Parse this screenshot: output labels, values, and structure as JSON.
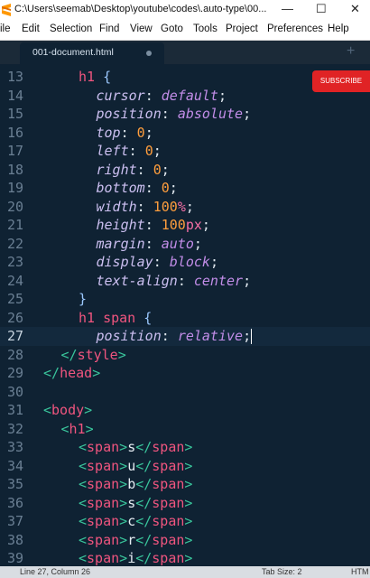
{
  "window": {
    "title": "C:\\Users\\seemab\\Desktop\\youtube\\codes\\.auto-type\\00...",
    "minimize": "—",
    "maximize": "☐",
    "close": "✕"
  },
  "menu": [
    "ile",
    "Edit",
    "Selection",
    "Find",
    "View",
    "Goto",
    "Tools",
    "Project",
    "Preferences",
    "Help"
  ],
  "tab": {
    "label": "001-document.html"
  },
  "overlay": {
    "subscribe_label": "SUBSCRIBE"
  },
  "lines": [
    {
      "n": "13",
      "parts": [
        [
          "sel",
          "h1"
        ],
        [
          "pun",
          " "
        ],
        [
          "br",
          "{"
        ]
      ]
    },
    {
      "n": "14",
      "parts": [
        [
          "prop",
          "cursor"
        ],
        [
          "pun",
          ": "
        ],
        [
          "val",
          "default"
        ],
        [
          "pun",
          ";"
        ]
      ]
    },
    {
      "n": "15",
      "parts": [
        [
          "prop",
          "position"
        ],
        [
          "pun",
          ": "
        ],
        [
          "val",
          "absolute"
        ],
        [
          "pun",
          ";"
        ]
      ]
    },
    {
      "n": "16",
      "parts": [
        [
          "prop",
          "top"
        ],
        [
          "pun",
          ": "
        ],
        [
          "num",
          "0"
        ],
        [
          "pun",
          ";"
        ]
      ]
    },
    {
      "n": "17",
      "parts": [
        [
          "prop",
          "left"
        ],
        [
          "pun",
          ": "
        ],
        [
          "num",
          "0"
        ],
        [
          "pun",
          ";"
        ]
      ]
    },
    {
      "n": "18",
      "parts": [
        [
          "prop",
          "right"
        ],
        [
          "pun",
          ": "
        ],
        [
          "num",
          "0"
        ],
        [
          "pun",
          ";"
        ]
      ]
    },
    {
      "n": "19",
      "parts": [
        [
          "prop",
          "bottom"
        ],
        [
          "pun",
          ": "
        ],
        [
          "num",
          "0"
        ],
        [
          "pun",
          ";"
        ]
      ]
    },
    {
      "n": "20",
      "parts": [
        [
          "prop",
          "width"
        ],
        [
          "pun",
          ": "
        ],
        [
          "num",
          "100"
        ],
        [
          "unit",
          "%"
        ],
        [
          "pun",
          ";"
        ]
      ]
    },
    {
      "n": "21",
      "parts": [
        [
          "prop",
          "height"
        ],
        [
          "pun",
          ": "
        ],
        [
          "num",
          "100"
        ],
        [
          "unit",
          "px"
        ],
        [
          "pun",
          ";"
        ]
      ]
    },
    {
      "n": "22",
      "parts": [
        [
          "prop",
          "margin"
        ],
        [
          "pun",
          ": "
        ],
        [
          "val",
          "auto"
        ],
        [
          "pun",
          ";"
        ]
      ]
    },
    {
      "n": "23",
      "parts": [
        [
          "prop",
          "display"
        ],
        [
          "pun",
          ": "
        ],
        [
          "val",
          "block"
        ],
        [
          "pun",
          ";"
        ]
      ]
    },
    {
      "n": "24",
      "parts": [
        [
          "prop",
          "text-align"
        ],
        [
          "pun",
          ": "
        ],
        [
          "val",
          "center"
        ],
        [
          "pun",
          ";"
        ]
      ]
    },
    {
      "n": "25",
      "parts": [
        [
          "br",
          "}"
        ]
      ]
    },
    {
      "n": "26",
      "parts": [
        [
          "sel",
          "h1 span"
        ],
        [
          "pun",
          " "
        ],
        [
          "br",
          "{"
        ]
      ]
    },
    {
      "n": "27",
      "parts": [
        [
          "prop",
          "position"
        ],
        [
          "pun",
          ": "
        ],
        [
          "val",
          "relative"
        ],
        [
          "pun",
          ";"
        ]
      ]
    },
    {
      "n": "28",
      "parts": [
        [
          "ang",
          "</"
        ],
        [
          "tag",
          "style"
        ],
        [
          "ang",
          ">"
        ]
      ]
    },
    {
      "n": "29",
      "parts": [
        [
          "ang",
          "</"
        ],
        [
          "tag",
          "head"
        ],
        [
          "ang",
          ">"
        ]
      ]
    },
    {
      "n": "30",
      "parts": []
    },
    {
      "n": "31",
      "parts": [
        [
          "ang",
          "<"
        ],
        [
          "tag",
          "body"
        ],
        [
          "ang",
          ">"
        ]
      ]
    },
    {
      "n": "32",
      "parts": [
        [
          "ang",
          "<"
        ],
        [
          "tag",
          "h1"
        ],
        [
          "ang",
          ">"
        ]
      ]
    },
    {
      "n": "33",
      "parts": [
        [
          "ang",
          "<"
        ],
        [
          "tag",
          "span"
        ],
        [
          "ang",
          ">"
        ],
        [
          "txt",
          "s"
        ],
        [
          "ang",
          "</"
        ],
        [
          "tag",
          "span"
        ],
        [
          "ang",
          ">"
        ]
      ]
    },
    {
      "n": "34",
      "parts": [
        [
          "ang",
          "<"
        ],
        [
          "tag",
          "span"
        ],
        [
          "ang",
          ">"
        ],
        [
          "txt",
          "u"
        ],
        [
          "ang",
          "</"
        ],
        [
          "tag",
          "span"
        ],
        [
          "ang",
          ">"
        ]
      ]
    },
    {
      "n": "35",
      "parts": [
        [
          "ang",
          "<"
        ],
        [
          "tag",
          "span"
        ],
        [
          "ang",
          ">"
        ],
        [
          "txt",
          "b"
        ],
        [
          "ang",
          "</"
        ],
        [
          "tag",
          "span"
        ],
        [
          "ang",
          ">"
        ]
      ]
    },
    {
      "n": "36",
      "parts": [
        [
          "ang",
          "<"
        ],
        [
          "tag",
          "span"
        ],
        [
          "ang",
          ">"
        ],
        [
          "txt",
          "s"
        ],
        [
          "ang",
          "</"
        ],
        [
          "tag",
          "span"
        ],
        [
          "ang",
          ">"
        ]
      ]
    },
    {
      "n": "37",
      "parts": [
        [
          "ang",
          "<"
        ],
        [
          "tag",
          "span"
        ],
        [
          "ang",
          ">"
        ],
        [
          "txt",
          "c"
        ],
        [
          "ang",
          "</"
        ],
        [
          "tag",
          "span"
        ],
        [
          "ang",
          ">"
        ]
      ]
    },
    {
      "n": "38",
      "parts": [
        [
          "ang",
          "<"
        ],
        [
          "tag",
          "span"
        ],
        [
          "ang",
          ">"
        ],
        [
          "txt",
          "r"
        ],
        [
          "ang",
          "</"
        ],
        [
          "tag",
          "span"
        ],
        [
          "ang",
          ">"
        ]
      ]
    },
    {
      "n": "39",
      "parts": [
        [
          "ang",
          "<"
        ],
        [
          "tag",
          "span"
        ],
        [
          "ang",
          ">"
        ],
        [
          "txt",
          "i"
        ],
        [
          "ang",
          "</"
        ],
        [
          "tag",
          "span"
        ],
        [
          "ang",
          ">"
        ]
      ]
    }
  ],
  "status": {
    "position": "Line 27, Column 26",
    "tab_size": "Tab Size: 2",
    "syntax": "HTM"
  }
}
